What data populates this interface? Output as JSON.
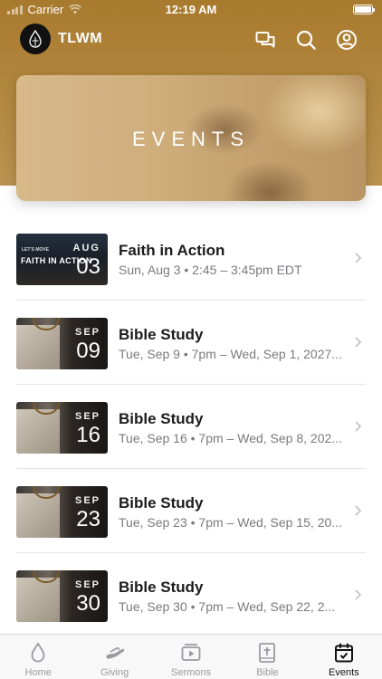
{
  "status": {
    "carrier": "Carrier",
    "time": "12:19 AM"
  },
  "header": {
    "brand": "TLWM"
  },
  "banner": {
    "title": "EVENTS"
  },
  "events": [
    {
      "title": "Faith in Action",
      "subtitle": "Sun, Aug 3 • 2:45 – 3:45pm EDT",
      "month": "AUG",
      "day": "03",
      "thumb_small": "LET'S MOVE",
      "thumb_big": "FAITH IN ACTION"
    },
    {
      "title": "Bible Study",
      "subtitle": "Tue, Sep 9 • 7pm – Wed, Sep 1, 2027...",
      "month": "SEP",
      "day": "09"
    },
    {
      "title": "Bible Study",
      "subtitle": "Tue, Sep 16 • 7pm – Wed, Sep 8, 202...",
      "month": "SEP",
      "day": "16"
    },
    {
      "title": "Bible Study",
      "subtitle": "Tue, Sep 23 • 7pm – Wed, Sep 15, 20...",
      "month": "SEP",
      "day": "23"
    },
    {
      "title": "Bible Study",
      "subtitle": "Tue, Sep 30 • 7pm – Wed, Sep 22, 2...",
      "month": "SEP",
      "day": "30"
    }
  ],
  "tabbar": {
    "items": [
      {
        "label": "Home",
        "icon": "drop-icon"
      },
      {
        "label": "Giving",
        "icon": "hands-icon"
      },
      {
        "label": "Sermons",
        "icon": "play-icon"
      },
      {
        "label": "Bible",
        "icon": "bible-icon"
      },
      {
        "label": "Events",
        "icon": "calendar-icon"
      }
    ],
    "active": "Events"
  },
  "colors": {
    "header_gold": "#b38840",
    "active_tab": "#111111",
    "inactive_tab": "#9a9aa0"
  }
}
